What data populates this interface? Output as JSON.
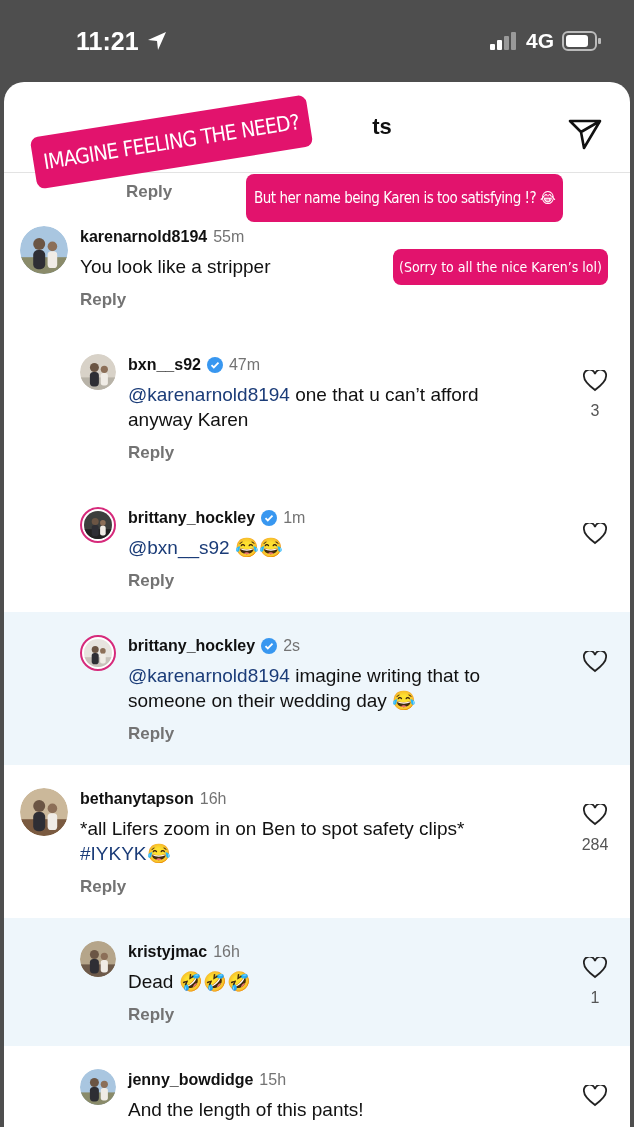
{
  "status_bar": {
    "time": "11:21",
    "network": "4G"
  },
  "header": {
    "title": "ts"
  },
  "stickers": [
    {
      "text": "IMAGINE FEELING THE NEED?",
      "kind": "tilted"
    },
    {
      "text": "But her name being Karen is too satisfying !? 😂",
      "kind": "large"
    },
    {
      "text": "(Sorry to all the nice Karen’s lol)",
      "kind": "small"
    }
  ],
  "clipped_reply": "Reply",
  "comments": [
    {
      "user": "karenarnold8194",
      "verified": false,
      "time": "55m",
      "story_ring": false,
      "highlighted": false,
      "liked_visible": false,
      "parts": [
        {
          "kind": "plain",
          "text": "You look like a stripper"
        }
      ],
      "reply": "Reply",
      "children": [
        {
          "user": "bxn__s92",
          "verified": true,
          "time": "47m",
          "story_ring": false,
          "highlighted": false,
          "liked_visible": true,
          "likes": "3",
          "parts": [
            {
              "kind": "mention",
              "text": "@karenarnold8194"
            },
            {
              "kind": "plain",
              "text": " one that u can’t afford anyway Karen"
            }
          ],
          "reply": "Reply"
        },
        {
          "user": "brittany_hockley",
          "verified": true,
          "time": "1m",
          "story_ring": true,
          "highlighted": false,
          "liked_visible": true,
          "parts": [
            {
              "kind": "mention",
              "text": "@bxn__s92"
            },
            {
              "kind": "plain",
              "text": " 😂😂"
            }
          ],
          "reply": "Reply"
        },
        {
          "user": "brittany_hockley",
          "verified": true,
          "time": "2s",
          "story_ring": true,
          "highlighted": true,
          "liked_visible": true,
          "parts": [
            {
              "kind": "mention",
              "text": "@karenarnold8194"
            },
            {
              "kind": "plain",
              "text": " imagine writing that to someone on their wedding day 😂"
            }
          ],
          "reply": "Reply"
        }
      ]
    },
    {
      "user": "bethanytapson",
      "verified": false,
      "time": "16h",
      "story_ring": false,
      "highlighted": false,
      "liked_visible": true,
      "likes": "284",
      "parts": [
        {
          "kind": "plain",
          "text": "*all Lifers zoom in on Ben to spot safety clips* "
        },
        {
          "kind": "mention",
          "text": "#IYKYK"
        },
        {
          "kind": "plain",
          "text": "😂"
        }
      ],
      "reply": "Reply",
      "children": [
        {
          "user": "kristyjmac",
          "verified": false,
          "time": "16h",
          "story_ring": false,
          "highlighted": true,
          "liked_visible": true,
          "likes": "1",
          "parts": [
            {
              "kind": "plain",
              "text": "Dead 🤣🤣🤣"
            }
          ],
          "reply": "Reply"
        },
        {
          "user": "jenny_bowdidge",
          "verified": false,
          "time": "15h",
          "story_ring": false,
          "highlighted": false,
          "liked_visible": true,
          "parts": [
            {
              "kind": "plain",
              "text": "And the length of this pants!"
            }
          ]
        }
      ]
    }
  ]
}
